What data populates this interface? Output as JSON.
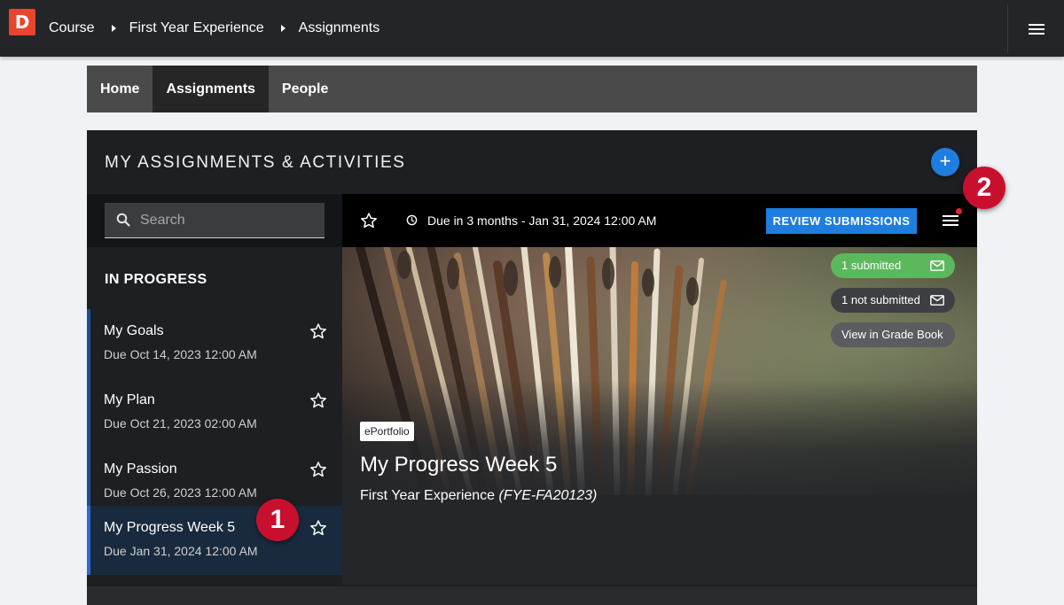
{
  "topbar": {
    "logo_letter": "D",
    "breadcrumbs": [
      "Course",
      "First Year Experience",
      "Assignments"
    ]
  },
  "nav": {
    "tabs": [
      {
        "label": "Home",
        "active": false
      },
      {
        "label": "Assignments",
        "active": true
      },
      {
        "label": "People",
        "active": false
      }
    ]
  },
  "panel": {
    "title": "MY ASSIGNMENTS & ACTIVITIES",
    "add_label": "+"
  },
  "sidebar": {
    "search_placeholder": "Search",
    "section_label": "IN PROGRESS",
    "items": [
      {
        "title": "My Goals",
        "due": "Due Oct 14, 2023 12:00 AM",
        "selected": false
      },
      {
        "title": "My Plan",
        "due": "Due Oct 21, 2023 02:00 AM",
        "selected": false
      },
      {
        "title": "My Passion",
        "due": "Due Oct 26, 2023 12:00 AM",
        "selected": false
      },
      {
        "title": "My Progress Week 5",
        "due": "Due Jan 31, 2024 12:00 AM",
        "selected": true
      }
    ]
  },
  "detail": {
    "due_text": "Due in 3 months - Jan 31, 2024 12:00 AM",
    "review_label": "REVIEW SUBMISSIONS",
    "pills": {
      "submitted": "1 submitted",
      "not_submitted": "1 not submitted",
      "grade_book": "View in Grade Book"
    },
    "tag": "ePortfolio",
    "title": "My Progress Week 5",
    "course_name": "First Year Experience",
    "course_code": "(FYE-FA20123)"
  },
  "callouts": [
    "1",
    "2"
  ],
  "colors": {
    "accent_blue": "#1f7de0",
    "logo_red": "#e8442e",
    "callout_red": "#c8102e",
    "submitted_green": "#5cb85c"
  }
}
